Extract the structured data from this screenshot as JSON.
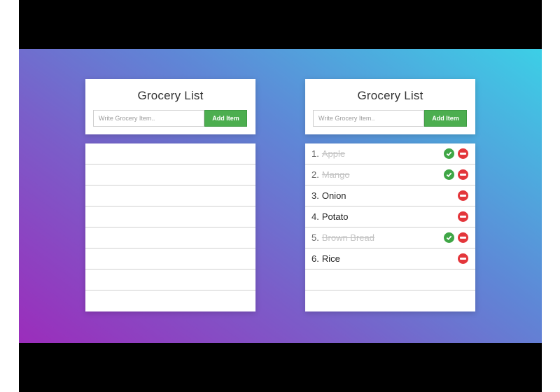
{
  "colors": {
    "accent_green": "#4cae4f",
    "check_green": "#3fa646",
    "remove_red": "#e3363b",
    "gradient_start": "#9b2dbb",
    "gradient_end": "#3ccfe6"
  },
  "left_app": {
    "title": "Grocery List",
    "input": {
      "value": "",
      "placeholder": "Write Grocery Item.."
    },
    "add_button_label": "Add Item",
    "items": []
  },
  "right_app": {
    "title": "Grocery List",
    "input": {
      "value": "",
      "placeholder": "Write Grocery Item.."
    },
    "add_button_label": "Add Item",
    "items": [
      {
        "number": "1.",
        "name": "Apple",
        "completed": true,
        "icons": [
          "check-icon",
          "remove-icon"
        ]
      },
      {
        "number": "2.",
        "name": "Mango",
        "completed": true,
        "icons": [
          "check-icon",
          "remove-icon"
        ]
      },
      {
        "number": "3.",
        "name": "Onion",
        "completed": false,
        "icons": [
          "remove-icon"
        ]
      },
      {
        "number": "4.",
        "name": "Potato",
        "completed": false,
        "icons": [
          "remove-icon"
        ]
      },
      {
        "number": "5.",
        "name": "Brown Bread",
        "completed": true,
        "icons": [
          "check-icon",
          "remove-icon"
        ]
      },
      {
        "number": "6.",
        "name": "Rice",
        "completed": false,
        "icons": [
          "remove-icon"
        ]
      }
    ]
  }
}
